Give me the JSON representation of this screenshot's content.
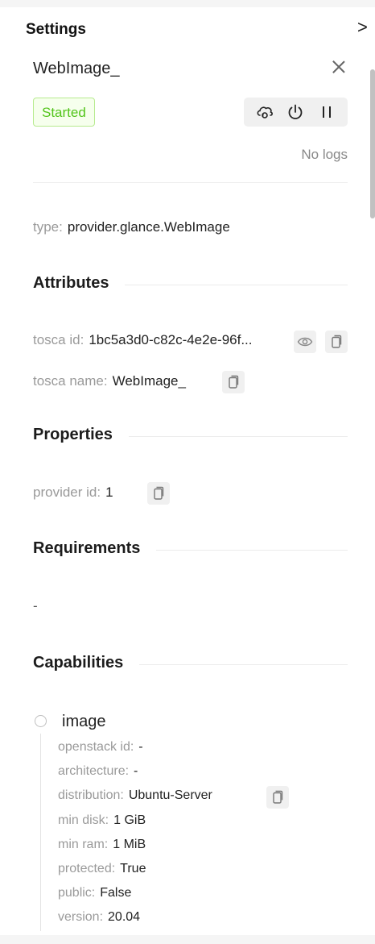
{
  "header": {
    "title": "Settings",
    "collapse_glyph": ">"
  },
  "node": {
    "name": "WebImage_",
    "status": "Started",
    "logs_text": "No logs"
  },
  "type_row": {
    "key": "type:",
    "value": "provider.glance.WebImage"
  },
  "sections": {
    "attributes": "Attributes",
    "properties": "Properties",
    "requirements": "Requirements",
    "capabilities": "Capabilities"
  },
  "attributes": {
    "tosca_id": {
      "key": "tosca id:",
      "value": "1bc5a3d0-c82c-4e2e-96f..."
    },
    "tosca_name": {
      "key": "tosca name:",
      "value": "WebImage_"
    }
  },
  "properties": {
    "provider_id": {
      "key": "provider id:",
      "value": "1"
    }
  },
  "requirements": {
    "empty_text": "-"
  },
  "capability": {
    "name": "image",
    "fields": [
      {
        "key": "openstack id:",
        "value": "-"
      },
      {
        "key": "architecture:",
        "value": "-"
      },
      {
        "key": "distribution:",
        "value": "Ubuntu-Server"
      },
      {
        "key": "min disk:",
        "value": "1 GiB"
      },
      {
        "key": "min ram:",
        "value": "1 MiB"
      },
      {
        "key": "protected:",
        "value": "True"
      },
      {
        "key": "public:",
        "value": "False"
      },
      {
        "key": "version:",
        "value": "20.04"
      }
    ]
  },
  "colors": {
    "status_green": "#52c41a",
    "status_bg": "#f6ffed",
    "muted": "#9a9a9a"
  },
  "icons": [
    "cloud-sync-icon",
    "power-icon",
    "pause-icon",
    "close-icon",
    "eye-icon",
    "copy-icon"
  ]
}
